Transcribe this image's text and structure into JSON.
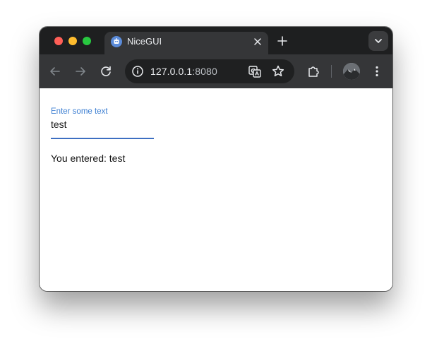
{
  "colors": {
    "titlebar": "#1e1f20",
    "toolbar": "#353638",
    "omnibox": "#1f2021",
    "accent": "#3d7fd2",
    "close": "#ff5f57",
    "minimize": "#febc2e",
    "maximize": "#28c840"
  },
  "window": {
    "traffic_lights": [
      "close",
      "minimize",
      "maximize"
    ]
  },
  "tabs": [
    {
      "title": "NiceGUI",
      "favicon": "nicegui-favicon",
      "active": true
    }
  ],
  "tabbar": {
    "new_tab_icon": "plus-icon",
    "tab_search_icon": "chevron-down-icon"
  },
  "toolbar": {
    "back_icon": "arrow-left-icon",
    "forward_icon": "arrow-right-icon",
    "reload_icon": "reload-icon",
    "site_info_icon": "info-icon",
    "url_host": "127.0.0.1",
    "url_port": ":8080",
    "translate_icon": "translate-icon",
    "bookmark_icon": "star-icon",
    "extensions_icon": "puzzle-icon",
    "menu_icon": "kebab-menu-icon"
  },
  "page": {
    "input_label": "Enter some text",
    "input_value": "test",
    "output": "You entered: test"
  }
}
